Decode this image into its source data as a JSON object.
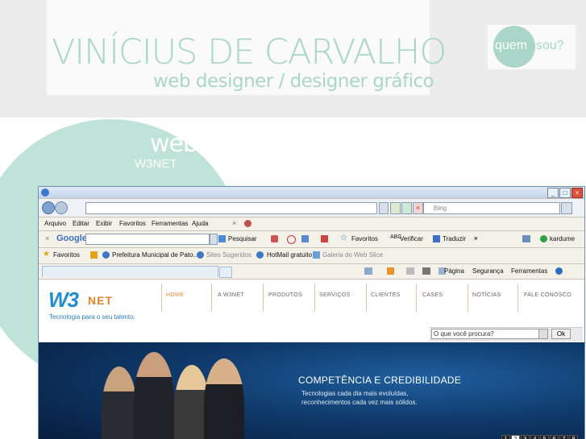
{
  "header": {
    "title": "VINÍCIUS DE CARVALHO",
    "subtitle": "web designer / designer gráfico",
    "quem": "quem",
    "sou": "sou?"
  },
  "section": {
    "title": "web site",
    "subtitle": "W3NET"
  },
  "browser": {
    "search_engine": "Bing",
    "menu": [
      "Arquivo",
      "Editar",
      "Exibir",
      "Favoritos",
      "Ferramentas",
      "Ajuda"
    ],
    "google": {
      "logo": "Google",
      "pesquisar": "Pesquisar",
      "favoritos": "Favoritos",
      "verificar": "Verificar",
      "traduzir": "Traduzir",
      "user": "kardume"
    },
    "favbar": {
      "favoritos": "Favoritos",
      "item1": "Prefeitura Municipal de Pato...",
      "item2": "Sites Sugeridos",
      "item3": "HotMail gratuito",
      "item4": "Galeria do Web Slice"
    },
    "cmd": {
      "pagina": "Página",
      "seguranca": "Segurança",
      "ferramentas": "Ferramentas"
    }
  },
  "site": {
    "logo_w3": "W3",
    "logo_net": "NET",
    "tagline": "Tecnologia para o seu talento.",
    "nav": [
      "HOME",
      "A W3NET",
      "PRODUTOS",
      "SERVIÇOS",
      "CLIENTES",
      "CASES",
      "NOTÍCIAS",
      "FALE CONOSCO"
    ],
    "search_placeholder": "O que você procura?",
    "ok": "Ok",
    "banner_title": "COMPETÊNCIA E CREDIBILIDADE",
    "banner_line1": "Tecnologias cada dia mais evoluídas,",
    "banner_line2": "reconhecimentos cada vez mais sólidos.",
    "pages": [
      "1",
      "2",
      "3",
      "4",
      "5",
      "6",
      "7",
      "8"
    ],
    "active_page": "2"
  },
  "colors": {
    "accent": "#a9d6c9",
    "brand_blue": "#1f8fd1",
    "brand_orange": "#e8832a",
    "active_nav": "#e8832a"
  }
}
